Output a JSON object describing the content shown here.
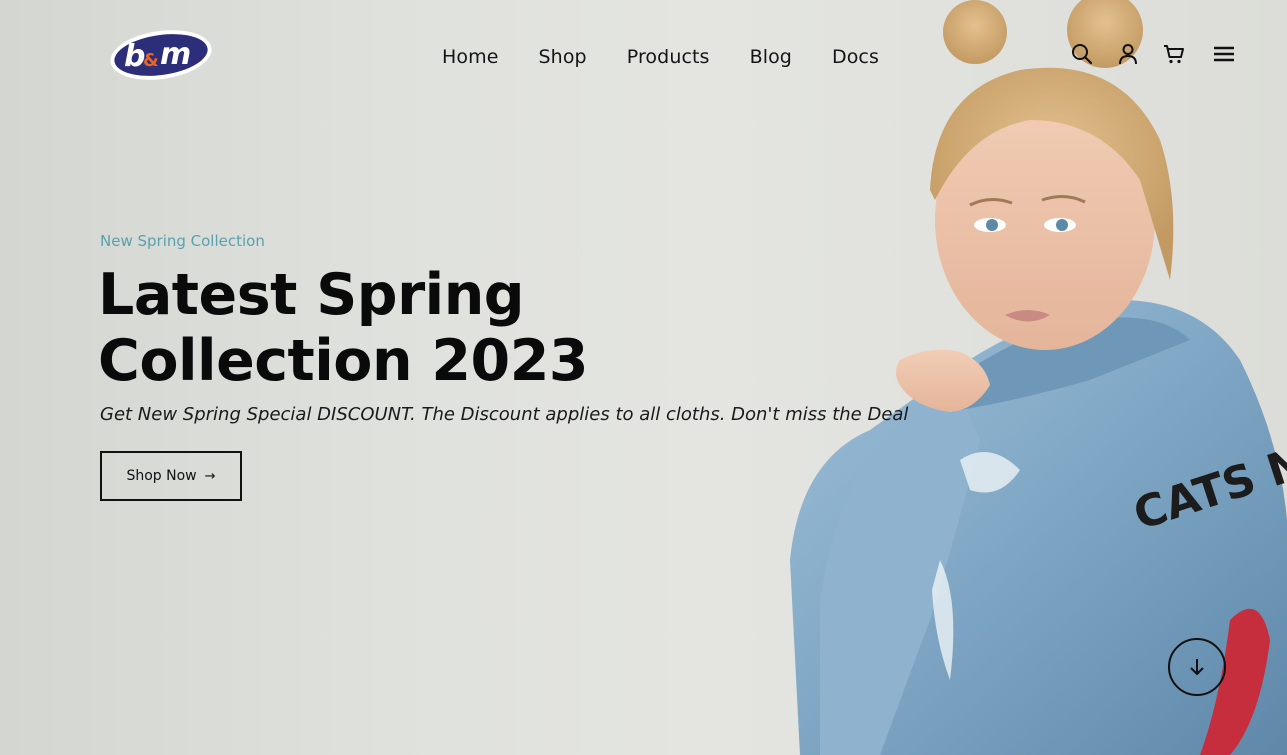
{
  "brand": {
    "logo_text": "b&m",
    "colors": {
      "primary": "#2c2e7a",
      "accent": "#e8652a"
    }
  },
  "nav": {
    "items": [
      {
        "label": "Home"
      },
      {
        "label": "Shop"
      },
      {
        "label": "Products"
      },
      {
        "label": "Blog"
      },
      {
        "label": "Docs"
      }
    ]
  },
  "header_icons": [
    "search-icon",
    "user-icon",
    "cart-icon",
    "menu-icon"
  ],
  "hero": {
    "eyebrow": "New Spring Collection",
    "title_line1": "Latest Spring",
    "title_line2": "Collection 2023",
    "subtitle": "Get New Spring Special DISCOUNT. The Discount applies to all cloths. Don't miss the Deal",
    "cta_label": "Shop Now",
    "cta_arrow": "→",
    "eyebrow_color": "#5aa1ad",
    "jacket_text": "CATS NOW"
  },
  "scroll_button_icon": "arrow-down-icon"
}
